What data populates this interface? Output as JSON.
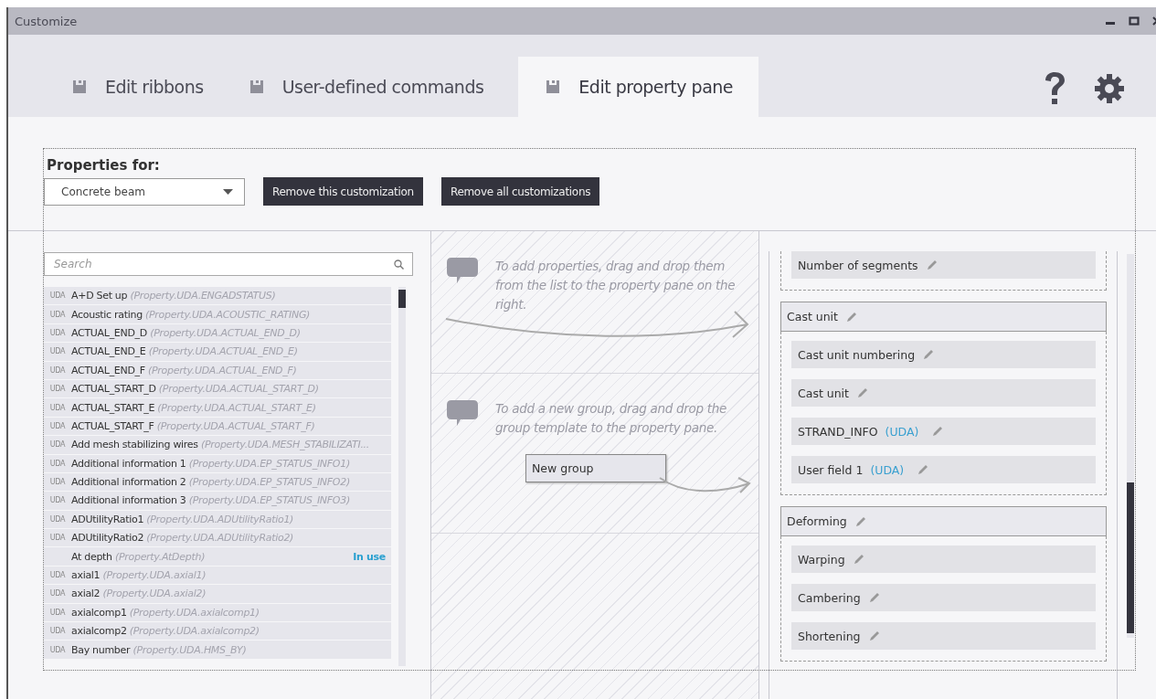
{
  "window": {
    "title": "Customize"
  },
  "tabs": [
    {
      "label": "Edit ribbons",
      "selected": false
    },
    {
      "label": "User-defined commands",
      "selected": false
    },
    {
      "label": "Edit property pane",
      "selected": true
    }
  ],
  "properties_for": {
    "label": "Properties for:",
    "dropdown": "Concrete beam",
    "buttons": [
      "Remove this customization",
      "Remove all customizations"
    ]
  },
  "search": {
    "placeholder": "Search"
  },
  "property_list": [
    {
      "prefix": "UDA",
      "name": "A+D Set up",
      "id": "(Property.UDA.ENGADSTATUS)"
    },
    {
      "prefix": "UDA",
      "name": "Acoustic rating",
      "id": "(Property.UDA.ACOUSTIC_RATING)"
    },
    {
      "prefix": "UDA",
      "name": "ACTUAL_END_D",
      "id": "(Property.UDA.ACTUAL_END_D)"
    },
    {
      "prefix": "UDA",
      "name": "ACTUAL_END_E",
      "id": "(Property.UDA.ACTUAL_END_E)"
    },
    {
      "prefix": "UDA",
      "name": "ACTUAL_END_F",
      "id": "(Property.UDA.ACTUAL_END_F)"
    },
    {
      "prefix": "UDA",
      "name": "ACTUAL_START_D",
      "id": "(Property.UDA.ACTUAL_START_D)"
    },
    {
      "prefix": "UDA",
      "name": "ACTUAL_START_E",
      "id": "(Property.UDA.ACTUAL_START_E)"
    },
    {
      "prefix": "UDA",
      "name": "ACTUAL_START_F",
      "id": "(Property.UDA.ACTUAL_START_F)"
    },
    {
      "prefix": "UDA",
      "name": "Add mesh stabilizing wires",
      "id": "(Property.UDA.MESH_STABILIZATI..."
    },
    {
      "prefix": "UDA",
      "name": "Additional information 1",
      "id": "(Property.UDA.EP_STATUS_INFO1)"
    },
    {
      "prefix": "UDA",
      "name": "Additional information 2",
      "id": "(Property.UDA.EP_STATUS_INFO2)"
    },
    {
      "prefix": "UDA",
      "name": "Additional information 3",
      "id": "(Property.UDA.EP_STATUS_INFO3)"
    },
    {
      "prefix": "UDA",
      "name": "ADUtilityRatio1",
      "id": "(Property.UDA.ADUtilityRatio1)"
    },
    {
      "prefix": "UDA",
      "name": "ADUtilityRatio2",
      "id": "(Property.UDA.ADUtilityRatio2)"
    },
    {
      "name": "At depth",
      "id": "(Property.AtDepth)",
      "status": "In use"
    },
    {
      "prefix": "UDA",
      "name": "axial1",
      "id": "(Property.UDA.axial1)"
    },
    {
      "prefix": "UDA",
      "name": "axial2",
      "id": "(Property.UDA.axial2)"
    },
    {
      "prefix": "UDA",
      "name": "axialcomp1",
      "id": "(Property.UDA.axialcomp1)"
    },
    {
      "prefix": "UDA",
      "name": "axialcomp2",
      "id": "(Property.UDA.axialcomp2)"
    },
    {
      "prefix": "UDA",
      "name": "Bay number",
      "id": "(Property.UDA.HMS_BY)"
    }
  ],
  "hints": [
    {
      "text": "To add properties, drag and drop them from the list to the property pane on the right."
    },
    {
      "text": "To add a new group, drag and drop the group template to the property pane.",
      "template": "New group"
    }
  ],
  "property_pane": [
    {
      "items": [
        {
          "label": "Number of segments"
        }
      ]
    },
    {
      "label": "Cast unit",
      "items": [
        {
          "label": "Cast unit numbering"
        },
        {
          "label": "Cast unit"
        },
        {
          "label": "STRAND_INFO",
          "tag": "(UDA)"
        },
        {
          "label": "User field 1",
          "tag": "(UDA)"
        }
      ]
    },
    {
      "label": "Deforming",
      "items": [
        {
          "label": "Warping"
        },
        {
          "label": "Cambering"
        },
        {
          "label": "Shortening"
        }
      ]
    }
  ]
}
